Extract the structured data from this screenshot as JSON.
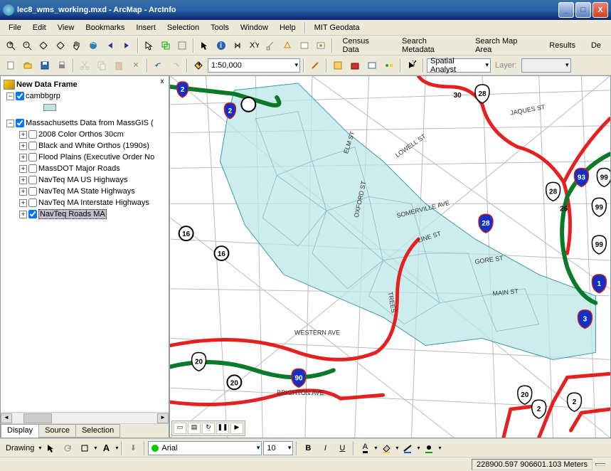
{
  "window": {
    "title": "lec8_wms_working.mxd - ArcMap - ArcInfo"
  },
  "menu": [
    "File",
    "Edit",
    "View",
    "Bookmarks",
    "Insert",
    "Selection",
    "Tools",
    "Window",
    "Help",
    "MIT Geodata"
  ],
  "toolbar1": {
    "links": [
      "Census Data",
      "Search Metadata",
      "Search Map Area",
      "Results",
      "De"
    ]
  },
  "toolbar2": {
    "scale": "1:50,000",
    "ext_dropdown": "Spatial Analyst",
    "layer_label": "Layer:"
  },
  "toc": {
    "close": "x",
    "dataframe": "New Data Frame",
    "layers": [
      {
        "label": "cambbgrp",
        "checked": true
      },
      {
        "label": "Massachusetts Data from MassGIS (",
        "checked": true,
        "group": true
      },
      {
        "label": "2008 Color Orthos 30cm",
        "checked": false
      },
      {
        "label": "Black and White Orthos (1990s)",
        "checked": false
      },
      {
        "label": "Flood Plains (Executive Order No",
        "checked": false
      },
      {
        "label": "MassDOT Major Roads",
        "checked": false
      },
      {
        "label": "NavTeq MA US Highways",
        "checked": false
      },
      {
        "label": "NavTeq MA State Highways",
        "checked": false
      },
      {
        "label": "NavTeq MA Interstate Highways",
        "checked": false
      },
      {
        "label": "NavTeq Roads MA",
        "checked": true,
        "selected": true
      }
    ],
    "tabs": [
      "Display",
      "Source",
      "Selection"
    ]
  },
  "drawing": {
    "label": "Drawing",
    "font": "Arial",
    "size": "10"
  },
  "status": {
    "coords": "228900.597 906601.103 Meters"
  },
  "map": {
    "streets": [
      "JAQUES ST",
      "LOWELL ST",
      "SOMERVILLE AVE",
      "LINE ST",
      "GORE ST",
      "MAIN ST",
      "WESTERN AVE",
      "BRIGHTON AVE",
      "ELM ST",
      "OXFORD ST",
      "TREES"
    ],
    "shields": {
      "interstate": [
        "2",
        "2",
        "93",
        "28",
        "90",
        "3",
        "1"
      ],
      "us": [
        "28",
        "28",
        "99",
        "99",
        "99",
        "26",
        "30",
        "20",
        "20",
        "2",
        "2"
      ],
      "circle": [
        "16",
        "16",
        "20"
      ]
    }
  }
}
